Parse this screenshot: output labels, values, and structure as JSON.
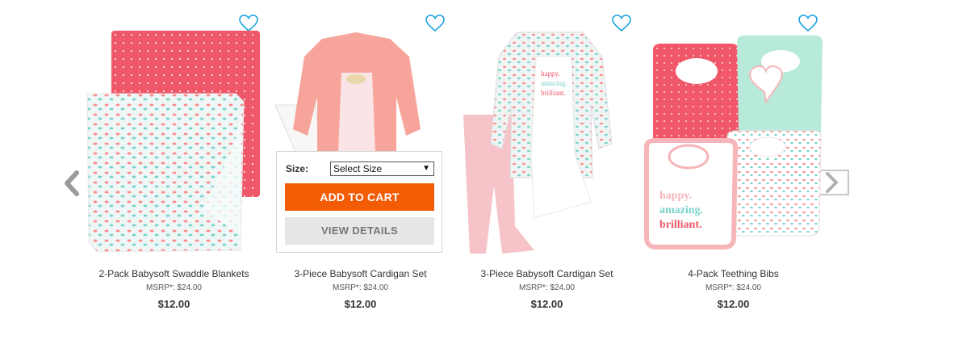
{
  "carousel": {
    "prev_icon": "chevron-left-icon",
    "next_icon": "chevron-right-icon",
    "colors": {
      "accent": "#f25c05",
      "heart": "#1aa3dd",
      "arrow": "#9a9a9a",
      "coral": "#f0586a",
      "mint": "#b7eadb",
      "pink": "#f6b6b9"
    },
    "products": [
      {
        "name": "2-Pack Babysoft Swaddle Blankets",
        "msrp": "MSRP*: $24.00",
        "price": "$12.00",
        "image": "swaddle-blankets",
        "icon": "heart-icon"
      },
      {
        "name": "3-Piece Babysoft Cardigan Set",
        "msrp": "MSRP*: $24.00",
        "price": "$12.00",
        "image": "pink-cardigan-set",
        "icon": "heart-icon"
      },
      {
        "name": "3-Piece Babysoft Cardigan Set",
        "msrp": "MSRP*: $24.00",
        "price": "$12.00",
        "image": "patterned-cardigan-set",
        "icon": "heart-icon"
      },
      {
        "name": "4-Pack Teething Bibs",
        "msrp": "MSRP*: $24.00",
        "price": "$12.00",
        "image": "teething-bibs",
        "icon": "heart-icon"
      }
    ],
    "quick_add": {
      "size_label": "Size:",
      "size_selected": "Select Size",
      "select_caret": "▼",
      "add_to_cart": "ADD TO CART",
      "view_details": "VIEW DETAILS"
    },
    "bib_text": {
      "line1": "happy.",
      "line2": "amazing.",
      "line3": "brilliant."
    }
  }
}
